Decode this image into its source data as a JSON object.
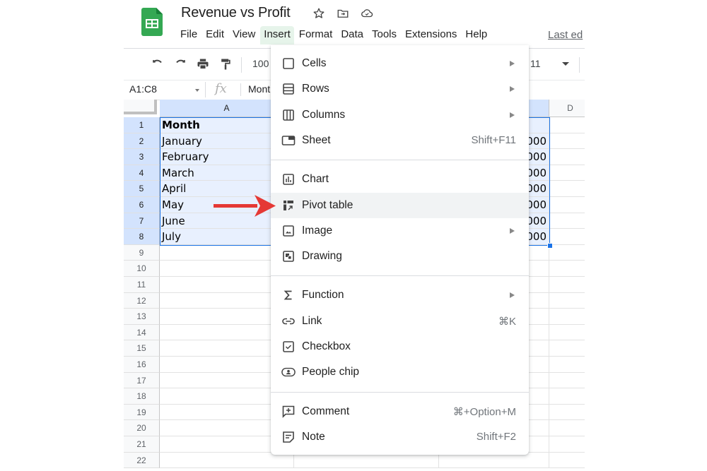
{
  "header": {
    "title": "Revenue vs Profit",
    "title_icons": [
      "star-icon",
      "move-to-folder-icon",
      "cloud-saved-icon"
    ],
    "menus": [
      "File",
      "Edit",
      "View",
      "Insert",
      "Format",
      "Data",
      "Tools",
      "Extensions",
      "Help"
    ],
    "active_menu": "Insert",
    "last_edit": "Last ed"
  },
  "toolbar": {
    "buttons": [
      "undo-icon",
      "redo-icon",
      "print-icon",
      "paint-format-icon"
    ],
    "zoom": "100",
    "font_size": "11"
  },
  "formula_bar": {
    "name_box": "A1:C8",
    "fx": "fx",
    "value": "Mont"
  },
  "grid": {
    "columns": [
      "A",
      "D"
    ],
    "rows": [
      "1",
      "2",
      "3",
      "4",
      "5",
      "6",
      "7",
      "8",
      "9",
      "10",
      "11",
      "12",
      "13",
      "14",
      "15",
      "16",
      "17",
      "18",
      "19",
      "20",
      "21",
      "22"
    ],
    "column_a": [
      "Month",
      "January",
      "February",
      "March",
      "April",
      "May",
      "June",
      "July"
    ],
    "column_c_visible": [
      "",
      "000",
      "000",
      "000",
      "000",
      "000",
      "000",
      "000"
    ],
    "selection": "A1:C8"
  },
  "insert_menu": {
    "groups": [
      [
        {
          "label": "Cells",
          "icon": "cells-icon",
          "submenu": true,
          "shortcut": ""
        },
        {
          "label": "Rows",
          "icon": "rows-icon",
          "submenu": true,
          "shortcut": ""
        },
        {
          "label": "Columns",
          "icon": "columns-icon",
          "submenu": true,
          "shortcut": ""
        },
        {
          "label": "Sheet",
          "icon": "sheet-icon",
          "submenu": false,
          "shortcut": "Shift+F11"
        }
      ],
      [
        {
          "label": "Chart",
          "icon": "chart-icon",
          "submenu": false,
          "shortcut": ""
        },
        {
          "label": "Pivot table",
          "icon": "pivot-table-icon",
          "submenu": false,
          "shortcut": "",
          "highlighted": true
        },
        {
          "label": "Image",
          "icon": "image-icon",
          "submenu": true,
          "shortcut": ""
        },
        {
          "label": "Drawing",
          "icon": "drawing-icon",
          "submenu": false,
          "shortcut": ""
        }
      ],
      [
        {
          "label": "Function",
          "icon": "function-sigma-icon",
          "submenu": true,
          "shortcut": ""
        },
        {
          "label": "Link",
          "icon": "link-icon",
          "submenu": false,
          "shortcut": "⌘K"
        },
        {
          "label": "Checkbox",
          "icon": "checkbox-icon",
          "submenu": false,
          "shortcut": ""
        },
        {
          "label": "People chip",
          "icon": "people-chip-icon",
          "submenu": false,
          "shortcut": ""
        }
      ],
      [
        {
          "label": "Comment",
          "icon": "comment-add-icon",
          "submenu": false,
          "shortcut": "⌘+Option+M"
        },
        {
          "label": "Note",
          "icon": "note-icon",
          "submenu": false,
          "shortcut": "Shift+F2"
        }
      ]
    ]
  },
  "annotation": {
    "type": "arrow",
    "points_to": "Pivot table",
    "color": "#e53935"
  },
  "colors": {
    "sheets_green": "#34a853",
    "selection_blue": "#1a73e8",
    "selection_fill": "#e8f0fe",
    "menu_active_bg": "#e6f4ea",
    "menu_hover_bg": "#f1f3f4"
  }
}
